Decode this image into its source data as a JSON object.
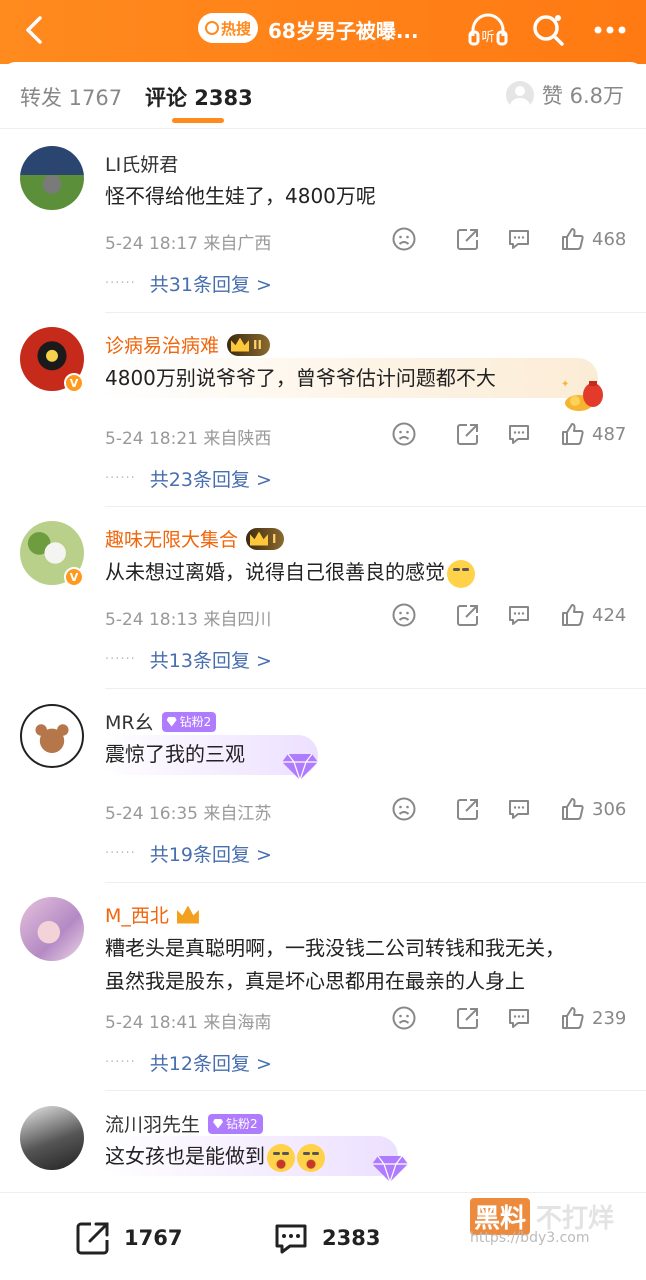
{
  "header": {
    "hot_label": "热搜",
    "title": "68岁男子被曝..."
  },
  "tabs": {
    "repost": "转发 1767",
    "comments": "评论 2383",
    "likes": "赞 6.8万"
  },
  "comments": [
    {
      "user": "LI氏妍君",
      "text_lines": [
        "怪不得给他生娃了，4800万呢"
      ],
      "time_location": "5-24 18:17  来自广西",
      "likes": "468",
      "replies": "共31条回复 >"
    },
    {
      "user": "诊病易治病难",
      "badge": "II",
      "text_lines": [
        "4800万别说爷爷了，曾爷爷估计问题都不大"
      ],
      "time_location": "5-24 18:21  来自陕西",
      "likes": "487",
      "replies": "共23条回复 >"
    },
    {
      "user": "趣味无限大集合",
      "badge": "I",
      "text_lines": [
        "从未想过离婚，说得自己很善良的感觉"
      ],
      "time_location": "5-24 18:13  来自四川",
      "likes": "424",
      "replies": "共13条回复 >"
    },
    {
      "user": "MR幺",
      "badge": "钻粉2",
      "text_lines": [
        "震惊了我的三观"
      ],
      "time_location": "5-24 16:35  来自江苏",
      "likes": "306",
      "replies": "共19条回复 >"
    },
    {
      "user": "M_西北",
      "text_lines": [
        "糟老头是真聪明啊，一我没钱二公司转钱和我无关，",
        "虽然我是股东，真是坏心思都用在最亲的人身上"
      ],
      "time_location": "5-24 18:41  来自海南",
      "likes": "239",
      "replies": "共12条回复 >"
    },
    {
      "user": "流川羽先生",
      "badge": "钻粉2",
      "text_lines": [
        "这女孩也是能做到"
      ]
    }
  ],
  "bottom": {
    "repost_count": "1767",
    "comment_count": "2383"
  },
  "watermark": {
    "brand": "黑料",
    "brand2": "不打烊",
    "url": "https://bdy3.com"
  },
  "colors": {
    "brand_orange": "#ff8a1e",
    "link_blue": "#476eaf",
    "name_orange": "#f0660b",
    "diamond_purple": "#b07cff"
  }
}
